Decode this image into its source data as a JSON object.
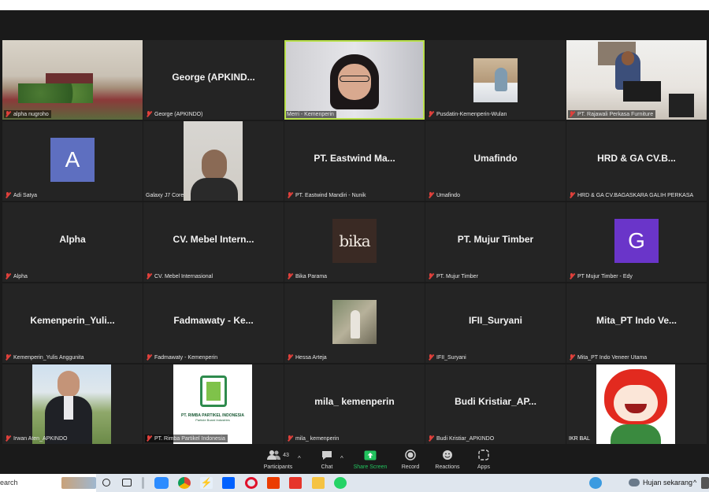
{
  "meeting": {
    "participants_count": "43"
  },
  "tiles": [
    {
      "label": "alpha nugroho",
      "center": "",
      "muted": true
    },
    {
      "label": "George (APKINDO)",
      "center": "George  (APKIND...",
      "muted": true
    },
    {
      "label": "Merri - Kemenperin",
      "center": "",
      "muted": false
    },
    {
      "label": "Pusdatin-Kemenperin-Wulan",
      "center": "",
      "muted": true
    },
    {
      "label": "PT. Rajawali Perkasa Furniture",
      "center": "",
      "muted": true
    },
    {
      "label": "Adi Satya",
      "center": "",
      "muted": true,
      "avatar": "A",
      "avatar_color": "#5e6fc0"
    },
    {
      "label": "Galaxy J7 Core",
      "center": "",
      "muted": false
    },
    {
      "label": "PT. Eastwind Mandiri - Nunik",
      "center": "PT. Eastwind Ma...",
      "muted": true
    },
    {
      "label": "Umafindo",
      "center": "Umafindo",
      "muted": true
    },
    {
      "label": "HRD & GA CV.BAGASKARA GALIH PERKASA",
      "center": "HRD & GA CV.B...",
      "muted": true
    },
    {
      "label": "Alpha",
      "center": "Alpha",
      "muted": true
    },
    {
      "label": "CV. Mebel Internasional",
      "center": "CV. Mebel Intern...",
      "muted": true
    },
    {
      "label": "Bika Parama",
      "center": "",
      "muted": true,
      "logo_text": "bika"
    },
    {
      "label": "PT. Mujur Timber",
      "center": "PT. Mujur Timber",
      "muted": true
    },
    {
      "label": "PT Mujur Timber - Edy",
      "center": "",
      "muted": true,
      "avatar": "G",
      "avatar_color": "#6a35c9"
    },
    {
      "label": "Kemenperin_Yulis Anggunita",
      "center": "Kemenperin_Yuli...",
      "muted": true
    },
    {
      "label": "Fadmawaty - Kemenperin",
      "center": "Fadmawaty  - Ke...",
      "muted": true
    },
    {
      "label": "Hessa Arteja",
      "center": "",
      "muted": true
    },
    {
      "label": "IFII_Suryani",
      "center": "IFII_Suryani",
      "muted": true
    },
    {
      "label": "Mita_PT Indo Veneer Utama",
      "center": "Mita_PT Indo Ve...",
      "muted": true
    },
    {
      "label": "Irwan Aten_APKINDO",
      "center": "",
      "muted": true
    },
    {
      "label": "PT. Rimba Partikel Indonesia",
      "center": "",
      "muted": true,
      "logo_text": "PT. RIMBA PARTIKEL INDONESIA",
      "logo_sub": "Particle Board Industries"
    },
    {
      "label": "mila_ kemenperin",
      "center": "mila_ kemenperin",
      "muted": true
    },
    {
      "label": "Budi Kristiar_APKINDO",
      "center": "Budi  Kristiar_AP...",
      "muted": true
    },
    {
      "label": "IKR BAL",
      "center": "",
      "muted": false
    }
  ],
  "toolbar": {
    "participants": "Participants",
    "chat": "Chat",
    "share": "Share Screen",
    "record": "Record",
    "reactions": "Reactions",
    "apps": "Apps"
  },
  "taskbar": {
    "search": "earch",
    "weather": "Hujan sekarang"
  },
  "colors": {
    "muted_red": "#e0403b",
    "share_green": "#22c35e",
    "active_speaker": "#b8e04a"
  }
}
